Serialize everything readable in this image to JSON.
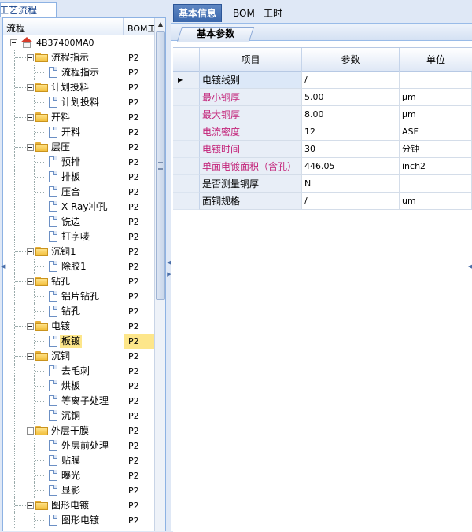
{
  "left_panel": {
    "tab_prefix": "",
    "tab_title": "工艺流程",
    "header": {
      "name": "流程",
      "bom": "BOM工"
    },
    "tree": [
      {
        "label": "4B37400MA0",
        "bom": "",
        "level": 0,
        "icon": "house-icon",
        "expandable": true
      },
      {
        "label": "流程指示",
        "bom": "P2",
        "level": 1,
        "icon": "folder-icon",
        "expandable": true
      },
      {
        "label": "流程指示",
        "bom": "P2",
        "level": 2,
        "icon": "doc-icon"
      },
      {
        "label": "计划投料",
        "bom": "P2",
        "level": 1,
        "icon": "folder-icon",
        "expandable": true
      },
      {
        "label": "计划投料",
        "bom": "P2",
        "level": 2,
        "icon": "doc-icon"
      },
      {
        "label": "开料",
        "bom": "P2",
        "level": 1,
        "icon": "folder-icon",
        "expandable": true
      },
      {
        "label": "开料",
        "bom": "P2",
        "level": 2,
        "icon": "doc-icon"
      },
      {
        "label": "层压",
        "bom": "P2",
        "level": 1,
        "icon": "folder-icon",
        "expandable": true
      },
      {
        "label": "预排",
        "bom": "P2",
        "level": 2,
        "icon": "doc-icon"
      },
      {
        "label": "排板",
        "bom": "P2",
        "level": 2,
        "icon": "doc-icon"
      },
      {
        "label": "压合",
        "bom": "P2",
        "level": 2,
        "icon": "doc-icon"
      },
      {
        "label": "X-Ray冲孔",
        "bom": "P2",
        "level": 2,
        "icon": "doc-icon"
      },
      {
        "label": "铣边",
        "bom": "P2",
        "level": 2,
        "icon": "doc-icon"
      },
      {
        "label": "打字唛",
        "bom": "P2",
        "level": 2,
        "icon": "doc-icon"
      },
      {
        "label": "沉铜1",
        "bom": "P2",
        "level": 1,
        "icon": "folder-icon",
        "expandable": true
      },
      {
        "label": "除胶1",
        "bom": "P2",
        "level": 2,
        "icon": "doc-icon"
      },
      {
        "label": "钻孔",
        "bom": "P2",
        "level": 1,
        "icon": "folder-icon",
        "expandable": true
      },
      {
        "label": "铝片钻孔",
        "bom": "P2",
        "level": 2,
        "icon": "doc-icon"
      },
      {
        "label": "钻孔",
        "bom": "P2",
        "level": 2,
        "icon": "doc-icon"
      },
      {
        "label": "电镀",
        "bom": "P2",
        "level": 1,
        "icon": "folder-icon",
        "expandable": true
      },
      {
        "label": "板镀",
        "bom": "P2",
        "level": 2,
        "icon": "doc-icon",
        "selected": true
      },
      {
        "label": "沉铜",
        "bom": "P2",
        "level": 1,
        "icon": "folder-icon",
        "expandable": true
      },
      {
        "label": "去毛刺",
        "bom": "P2",
        "level": 2,
        "icon": "doc-icon"
      },
      {
        "label": "烘板",
        "bom": "P2",
        "level": 2,
        "icon": "doc-icon"
      },
      {
        "label": "等离子处理",
        "bom": "P2",
        "level": 2,
        "icon": "doc-icon"
      },
      {
        "label": "沉铜",
        "bom": "P2",
        "level": 2,
        "icon": "doc-icon"
      },
      {
        "label": "外层干膜",
        "bom": "P2",
        "level": 1,
        "icon": "folder-icon",
        "expandable": true
      },
      {
        "label": "外层前处理",
        "bom": "P2",
        "level": 2,
        "icon": "doc-icon"
      },
      {
        "label": "贴膜",
        "bom": "P2",
        "level": 2,
        "icon": "doc-icon"
      },
      {
        "label": "曝光",
        "bom": "P2",
        "level": 2,
        "icon": "doc-icon"
      },
      {
        "label": "显影",
        "bom": "P2",
        "level": 2,
        "icon": "doc-icon"
      },
      {
        "label": "图形电镀",
        "bom": "P2",
        "level": 1,
        "icon": "folder-icon",
        "expandable": true
      },
      {
        "label": "图形电镀",
        "bom": "P2",
        "level": 2,
        "icon": "doc-icon"
      }
    ]
  },
  "right_panel": {
    "tabs": [
      {
        "label": "基本信息",
        "active": true
      },
      {
        "label": "BOM",
        "active": false
      },
      {
        "label": "工时",
        "active": false
      }
    ],
    "subtab": "基本参数",
    "grid": {
      "columns": [
        "项目",
        "参数",
        "单位"
      ],
      "rows": [
        {
          "item": "电镀线别",
          "param": "/",
          "unit": "",
          "current": true,
          "item_color": "black",
          "editable": true
        },
        {
          "item": "最小铜厚",
          "param": "5.00",
          "unit": "μm",
          "item_color": "pink",
          "editable": true
        },
        {
          "item": "最大铜厚",
          "param": "8.00",
          "unit": "μm",
          "item_color": "pink",
          "editable": true
        },
        {
          "item": "电流密度",
          "param": "12",
          "unit": "ASF",
          "item_color": "pink",
          "editable": false
        },
        {
          "item": "电镀时间",
          "param": "30",
          "unit": "分钟",
          "item_color": "pink",
          "editable": true
        },
        {
          "item": "单面电镀面积（含孔）",
          "param": "446.05",
          "unit": "inch2",
          "item_color": "pink",
          "editable": false
        },
        {
          "item": "是否测量铜厚",
          "param": "N",
          "unit": "",
          "item_color": "black",
          "editable": true
        },
        {
          "item": "面铜规格",
          "param": "/",
          "unit": "um",
          "item_color": "black",
          "editable": false
        }
      ]
    }
  },
  "colors": {
    "accent_tab": "#3b68ad",
    "pink_label": "#c3247a",
    "selection": "#fde68a",
    "frame": "#dfe8f6"
  }
}
